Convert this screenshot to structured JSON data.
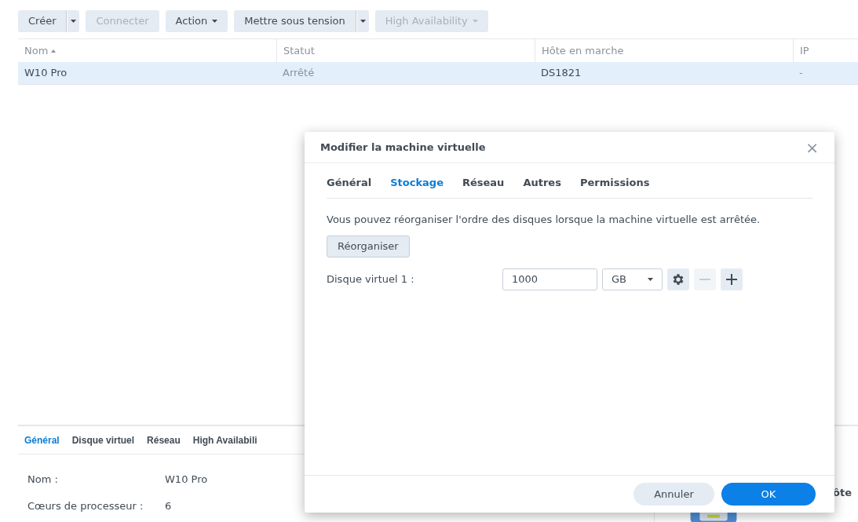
{
  "toolbar": [
    {
      "label": "Créer",
      "disabled": false,
      "split": true,
      "caret": false
    },
    {
      "label": "Connecter",
      "disabled": true,
      "split": false,
      "caret": false
    },
    {
      "label": "Action",
      "disabled": false,
      "split": false,
      "caret": true
    },
    {
      "label": "Mettre sous tension",
      "disabled": false,
      "split": true,
      "caret": false
    },
    {
      "label": "High Availability",
      "disabled": true,
      "split": false,
      "caret": true
    }
  ],
  "table": {
    "columns": [
      {
        "label": "Nom",
        "sorted": true
      },
      {
        "label": "Statut",
        "sorted": false
      },
      {
        "label": "Hôte en marche",
        "sorted": false
      },
      {
        "label": "IP",
        "sorted": false
      }
    ],
    "rows": [
      {
        "selected": true,
        "cells": [
          "W10 Pro",
          "Arrêté",
          "DS1821",
          "-"
        ]
      }
    ]
  },
  "details": {
    "tabs": [
      {
        "label": "Général",
        "selected": true
      },
      {
        "label": "Disque virtuel",
        "selected": false
      },
      {
        "label": "Réseau",
        "selected": false
      },
      {
        "label": "High Availabili",
        "selected": false
      }
    ],
    "fields": [
      {
        "label": "Nom :",
        "value": "W10 Pro"
      },
      {
        "label": "Cœurs de processeur :",
        "value": "6"
      }
    ],
    "side_card": {
      "title": "ôte"
    }
  },
  "dialog": {
    "title": "Modifier la machine virtuelle",
    "close": "×",
    "tabs": [
      {
        "label": "Général",
        "selected": false
      },
      {
        "label": "Stockage",
        "selected": true
      },
      {
        "label": "Réseau",
        "selected": false
      },
      {
        "label": "Autres",
        "selected": false
      },
      {
        "label": "Permissions",
        "selected": false
      }
    ],
    "note": "Vous pouvez réorganiser l'ordre des disques lorsque la machine virtuelle est arrêtée.",
    "reorder_button": "Réorganiser",
    "disks": [
      {
        "label": "Disque virtuel 1 :",
        "size": "1000",
        "unit": "GB",
        "remove_disabled": true
      }
    ],
    "buttons": [
      {
        "label": "Annuler",
        "kind": "secondary"
      },
      {
        "label": "OK",
        "kind": "primary"
      }
    ]
  }
}
